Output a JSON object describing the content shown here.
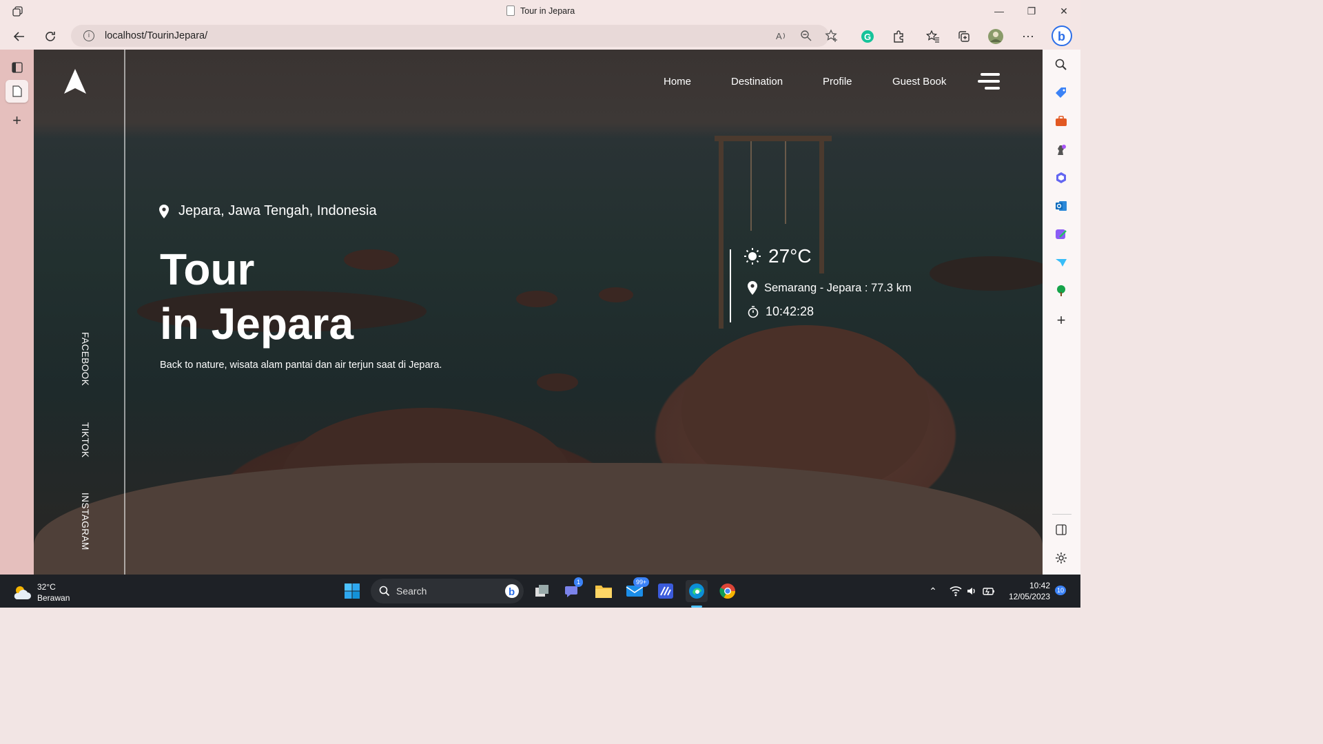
{
  "browser": {
    "tab_title": "Tour in Jepara",
    "url": "localhost/TourinJepara/"
  },
  "site": {
    "nav": [
      "Home",
      "Destination",
      "Profile",
      "Guest Book"
    ],
    "socials": [
      "FACEBOOK",
      "TIKTOK",
      "INSTAGRAM"
    ],
    "location": "Jepara, Jawa Tengah, Indonesia",
    "title_line1": "Tour",
    "title_line2": "in Jepara",
    "subtitle": "Back to nature, wisata alam pantai dan air terjun saat di Jepara.",
    "weather": {
      "temperature": "27°C",
      "distance": "Semarang - Jepara : 77.3 km",
      "time": "10:42:28"
    }
  },
  "taskbar": {
    "weather_temp": "32°C",
    "weather_desc": "Berawan",
    "search_label": "Search",
    "clock_time": "10:42",
    "clock_date": "12/05/2023",
    "teams_badge": "1",
    "mail_badge": "99+",
    "notif_badge": "10"
  }
}
